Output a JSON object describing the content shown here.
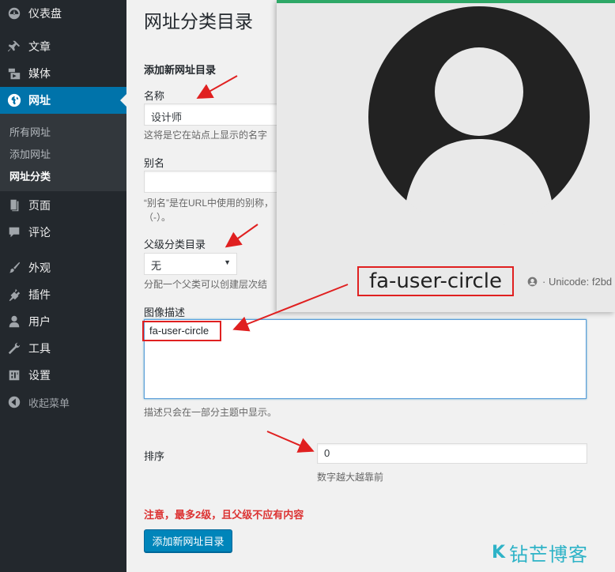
{
  "sidebar": {
    "items": [
      {
        "label": "仪表盘",
        "icon": "dashboard-icon"
      },
      {
        "label": "文章",
        "icon": "pin-icon"
      },
      {
        "label": "媒体",
        "icon": "media-icon"
      },
      {
        "label": "网址",
        "icon": "globe-icon"
      },
      {
        "label": "页面",
        "icon": "page-icon"
      },
      {
        "label": "评论",
        "icon": "comment-icon"
      },
      {
        "label": "外观",
        "icon": "brush-icon"
      },
      {
        "label": "插件",
        "icon": "plugin-icon"
      },
      {
        "label": "用户",
        "icon": "user-icon"
      },
      {
        "label": "工具",
        "icon": "wrench-icon"
      },
      {
        "label": "设置",
        "icon": "settings-icon"
      }
    ],
    "submenu": [
      "所有网址",
      "添加网址",
      "网址分类"
    ],
    "collapse_label": "收起菜单"
  },
  "main": {
    "page_title": "网址分类目录",
    "section_title": "添加新网址目录",
    "name_label": "名称",
    "name_value": "设计师",
    "name_desc": "这将是它在站点上显示的名字",
    "slug_label": "别名",
    "slug_value": "",
    "slug_desc_1": "“别名”是在URL中使用的别称，",
    "slug_desc_2": "（-）。",
    "parent_label": "父级分类目录",
    "parent_value": "无",
    "parent_desc": "分配一个父类可以创建层次结",
    "image_label": "图像描述",
    "image_value": "fa-user-circle",
    "image_desc": "描述只会在一部分主题中显示。",
    "order_label": "排序",
    "order_value": "0",
    "order_desc": "数字越大越靠前",
    "warning": "注意，最多2级，且父级不应有内容",
    "submit_label": "添加新网址目录"
  },
  "overlay": {
    "icon_name": "fa-user-circle",
    "unicode_text": "· Unicode: f2bd"
  },
  "watermark": {
    "mark": "K",
    "text": "钻芒博客"
  },
  "colors": {
    "sidebar_bg": "#23282d",
    "active_bg": "#0073aa",
    "annotation_red": "#e02020",
    "overlay_accent": "#2ea867",
    "button_blue": "#0085ba"
  }
}
